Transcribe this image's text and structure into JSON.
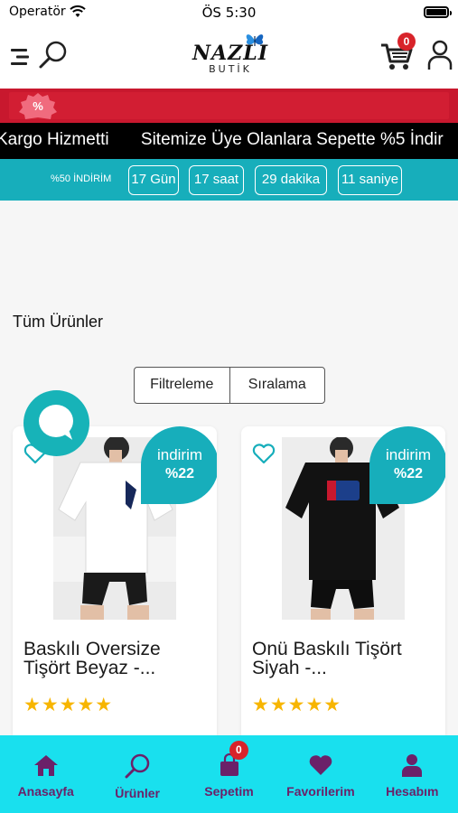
{
  "status_bar": {
    "carrier": "Operatör",
    "time": "ÖS 5:30"
  },
  "header": {
    "logo_text": "NAZLI",
    "logo_sub": "BUTİK",
    "cart_count": "0"
  },
  "promo": {
    "marquee_items": [
      "Kargo Hizmetti",
      "Sitemize Üye Olanlara Sepette %5 İndir"
    ],
    "countdown_label": "%50 İNDİRİM",
    "countdown": {
      "days": "17 Gün",
      "hours": "17 saat",
      "minutes": "29 dakika",
      "seconds": "11 saniye"
    }
  },
  "main": {
    "section_title": "Tüm Ürünler",
    "filter_label": "Filtreleme",
    "sort_label": "Sıralama"
  },
  "products": [
    {
      "name": "Baskılı Oversize Tişört Beyaz -...",
      "discount_label": "indirim",
      "discount_value": "%22",
      "rating": 5,
      "stars": "★★★★★",
      "shirt_color": "#ffffff"
    },
    {
      "name": "Onü Baskılı Tişört Siyah -...",
      "discount_label": "indirim",
      "discount_value": "%22",
      "rating": 5,
      "stars": "★★★★★",
      "shirt_color": "#111111"
    }
  ],
  "bottom_nav": {
    "items": [
      {
        "label": "Anasayfa",
        "icon": "home-icon"
      },
      {
        "label": "Ürünler",
        "icon": "search-icon"
      },
      {
        "label": "Sepetim",
        "icon": "shopping-bag-icon"
      },
      {
        "label": "Favorilerim",
        "icon": "heart-icon"
      },
      {
        "label": "Hesabım",
        "icon": "person-icon"
      }
    ],
    "cart_badge": "0"
  },
  "colors": {
    "teal": "#17aebb",
    "nav_bg": "#19e0ee",
    "nav_text": "#6b2169",
    "red_bar": "#c8182e",
    "badge_red": "#d8232a",
    "star": "#f7b500"
  }
}
